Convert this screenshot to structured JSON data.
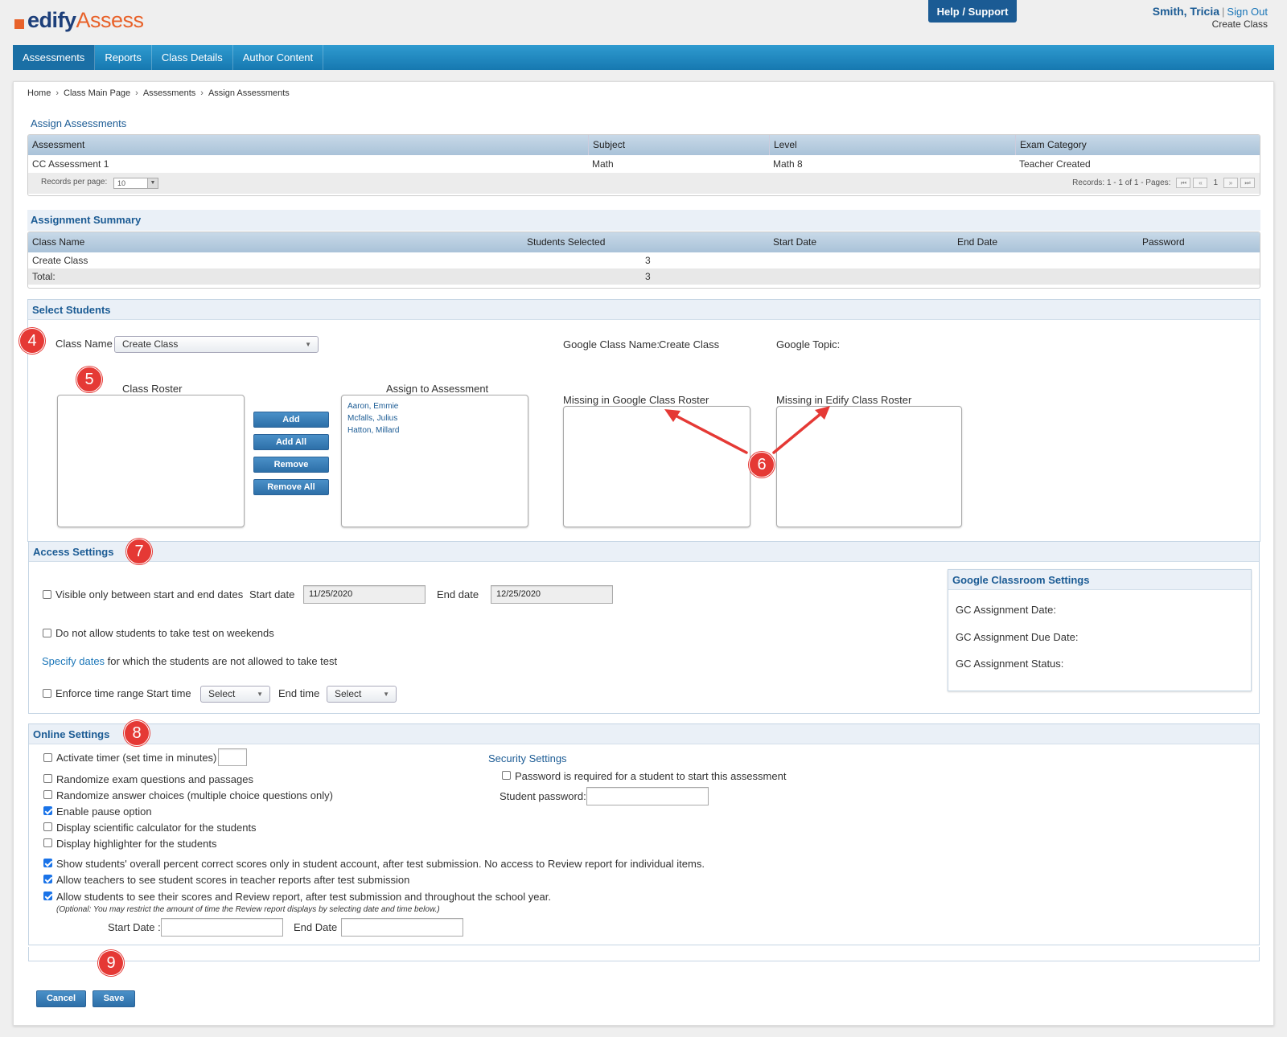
{
  "header": {
    "logo_part1": "edify",
    "logo_part2": "Assess",
    "help_label": "Help / Support",
    "user_name": "Smith, Tricia",
    "separator": "|",
    "sign_out": "Sign Out",
    "current_class": "Create Class"
  },
  "nav": {
    "items": [
      "Assessments",
      "Reports",
      "Class Details",
      "Author Content"
    ],
    "active": "Assessments"
  },
  "breadcrumb": [
    "Home",
    "Class Main Page",
    "Assessments",
    "Assign Assessments"
  ],
  "breadcrumb_sep": "›",
  "assign": {
    "title": "Assign Assessments",
    "columns": [
      "Assessment",
      "Subject",
      "Level",
      "Exam Category"
    ],
    "row": [
      "CC Assessment 1",
      "Math",
      "Math 8",
      "Teacher Created"
    ],
    "records_per_page_label": "Records per page:",
    "records_per_page_value": "10",
    "records_info": "Records: 1 - 1 of 1 - Pages:",
    "pager_first": "⏮",
    "pager_prev": "«",
    "current_page": "1",
    "pager_next": "»",
    "pager_last": "⏭"
  },
  "summary": {
    "title": "Assignment Summary",
    "columns": [
      "Class Name",
      "Students Selected",
      "Start Date",
      "End Date",
      "Password"
    ],
    "row": {
      "class_name": "Create Class",
      "students": "3"
    },
    "total_label": "Total:",
    "total_value": "3"
  },
  "select_students": {
    "title": "Select Students",
    "class_name_label": "Class Name",
    "class_name_value": "Create Class",
    "google_class_label": "Google Class Name:",
    "google_class_value": "Create Class",
    "google_topic_label": "Google Topic:",
    "roster_label": "Class Roster",
    "assign_label": "Assign to Assessment",
    "assigned_students": [
      "Aaron, Emmie",
      "Mcfalls, Julius",
      "Hatton, Millard"
    ],
    "buttons": [
      "Add",
      "Add All",
      "Remove",
      "Remove All"
    ],
    "missing_google_label": "Missing in Google Class Roster",
    "missing_edify_label": "Missing in Edify Class Roster"
  },
  "access": {
    "title": "Access Settings",
    "visible_label": "Visible only between start and end dates",
    "start_date_label": "Start date",
    "start_date_value": "11/25/2020",
    "end_date_label": "End date",
    "end_date_value": "12/25/2020",
    "weekends_label": "Do not allow students to take test on weekends",
    "specify_link": "Specify dates",
    "specify_rest": "for which the students are not allowed to take test",
    "enforce_label": "Enforce time range",
    "start_time_label": "Start time",
    "start_time_value": "Select",
    "end_time_label": "End time",
    "end_time_value": "Select"
  },
  "gc_settings": {
    "title": "Google Classroom Settings",
    "assignment_date": "GC Assignment Date:",
    "due_date": "GC Assignment Due Date:",
    "status": "GC Assignment Status:"
  },
  "online": {
    "title": "Online Settings",
    "options": [
      {
        "label": "Activate timer (set time in minutes)",
        "checked": false
      },
      {
        "label": "Randomize exam questions and passages",
        "checked": false
      },
      {
        "label": "Randomize answer choices (multiple choice questions only)",
        "checked": false
      },
      {
        "label": "Enable pause option",
        "checked": true
      },
      {
        "label": "Display scientific calculator for the students",
        "checked": false
      },
      {
        "label": "Display highlighter for the students",
        "checked": false
      },
      {
        "label": "Show students' overall percent correct scores only in student account, after test submission. No access to Review report for individual items.",
        "checked": true
      },
      {
        "label": "Allow teachers to see student scores in teacher reports after test submission",
        "checked": true
      },
      {
        "label": "Allow students to see their scores and Review report, after test submission and throughout the school year.",
        "checked": true
      }
    ],
    "optional_note": "(Optional: You may restrict the amount of time the Review report displays by selecting date and time below.)",
    "start_date_label": "Start Date :",
    "end_date_label": "End Date :",
    "security_title": "Security Settings",
    "password_required_label": "Password is required for a student to start this assessment",
    "student_password_label": "Student password:"
  },
  "annotations": {
    "badge4": "4",
    "badge5": "5",
    "badge6": "6",
    "badge7": "7",
    "badge8": "8",
    "badge9": "9",
    "color": "#e53935"
  },
  "footer": {
    "cancel_label": "Cancel",
    "save_label": "Save"
  }
}
